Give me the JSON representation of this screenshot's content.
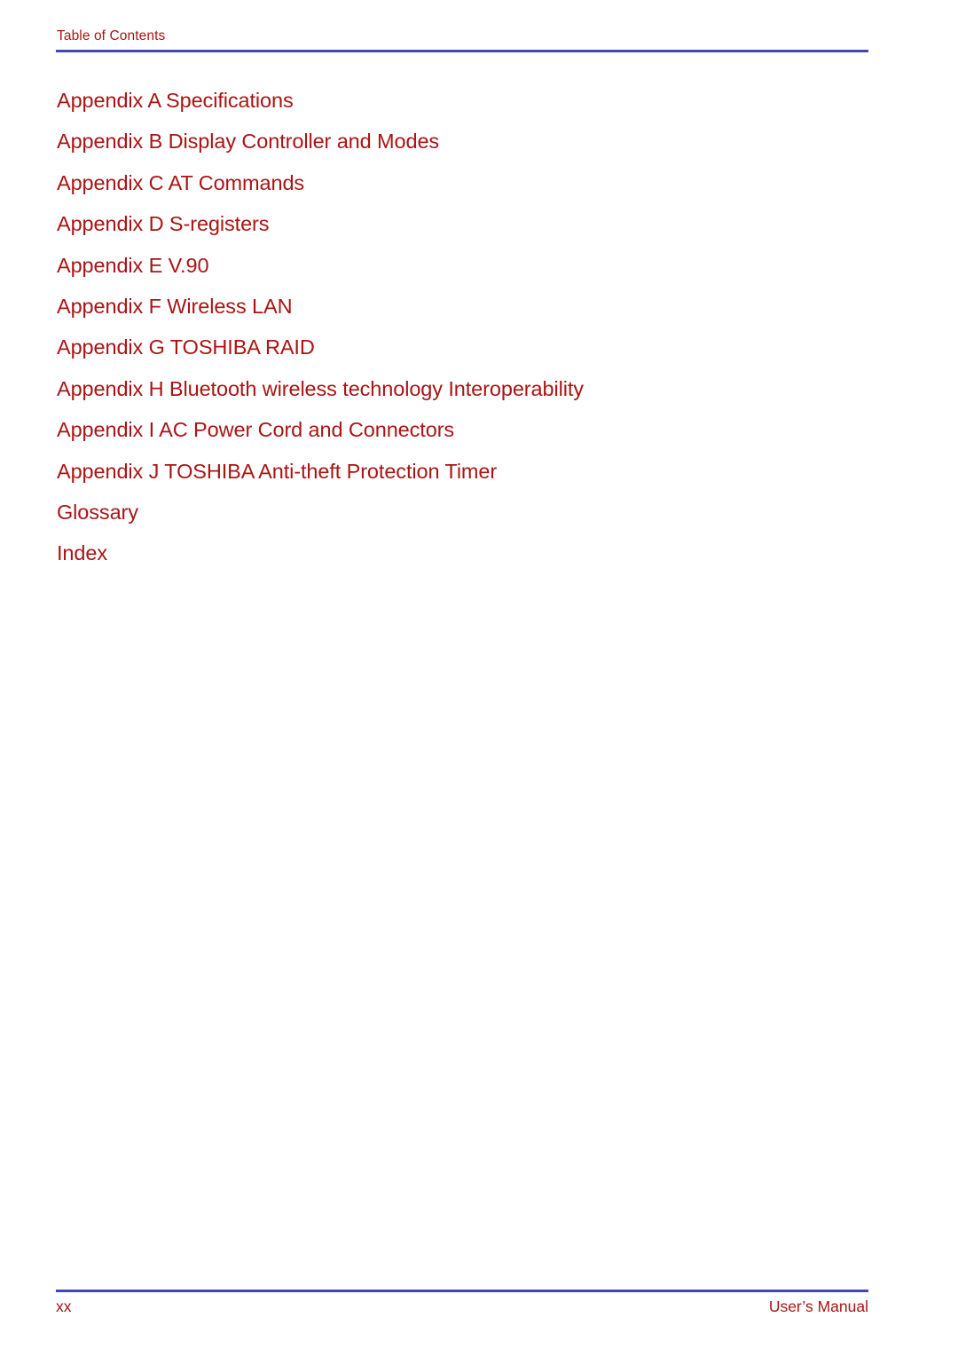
{
  "page": {
    "background_color": "#ffffff",
    "accent_rule_color": "#4545B5",
    "text_color": "#AA1414"
  },
  "header": {
    "title": "Table of Contents"
  },
  "toc": {
    "entries": [
      {
        "label": "Appendix A Specifications"
      },
      {
        "label": "Appendix B Display Controller and Modes"
      },
      {
        "label": "Appendix C AT Commands"
      },
      {
        "label": "Appendix D S-registers"
      },
      {
        "label": "Appendix E V.90"
      },
      {
        "label": "Appendix F Wireless LAN"
      },
      {
        "label": "Appendix G TOSHIBA RAID"
      },
      {
        "label": "Appendix H Bluetooth wireless technology Interoperability"
      },
      {
        "label": "Appendix I AC Power Cord and Connectors"
      },
      {
        "label": "Appendix J TOSHIBA Anti-theft Protection Timer"
      },
      {
        "label": "Glossary"
      },
      {
        "label": "Index"
      }
    ]
  },
  "footer": {
    "page_number": "xx",
    "document_title": "User’s Manual"
  }
}
